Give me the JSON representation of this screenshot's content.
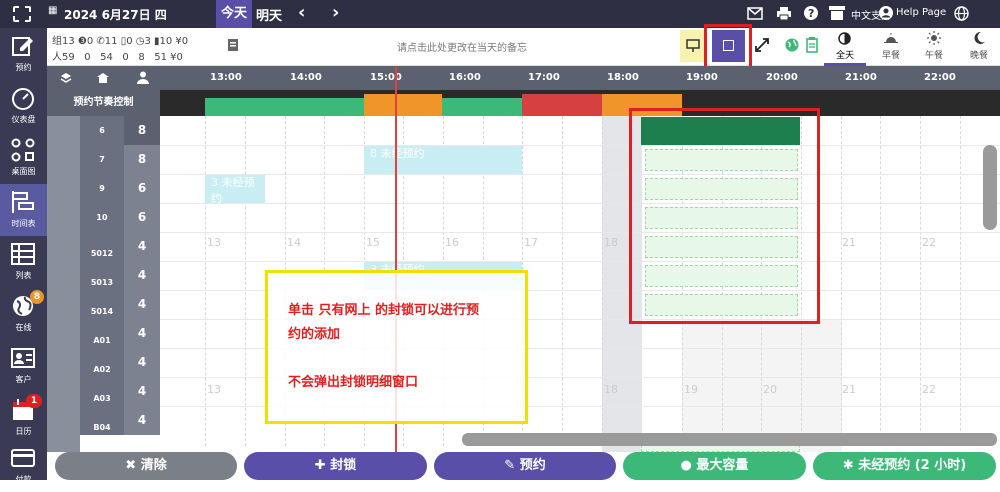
{
  "topbar": {
    "date": "2024 6月27日 四",
    "today": "今天",
    "tomorrow": "明天",
    "prev": "‹",
    "next": "›",
    "lang_support": "中文支持",
    "help": "Help Page"
  },
  "sidebar": [
    {
      "label": "预约",
      "icon": "edit-icon"
    },
    {
      "label": "仪表盘",
      "icon": "gauge-icon"
    },
    {
      "label": "桌面图",
      "icon": "floorplan-icon"
    },
    {
      "label": "时间表",
      "icon": "timeline-icon",
      "active": true
    },
    {
      "label": "列表",
      "icon": "list-icon"
    },
    {
      "label": "在线",
      "icon": "globe-icon",
      "badge": "8"
    },
    {
      "label": "客户",
      "icon": "contact-icon"
    },
    {
      "label": "日历",
      "icon": "calendar-icon",
      "badge": "1"
    },
    {
      "label": "付款",
      "icon": "card-icon"
    }
  ],
  "toolbar": {
    "stats_line1": "组13 ❸0 ✆11 ▯0 ◷3 ▮10 ¥0",
    "stats_line2": "人59   0   54   0   8   51 ¥0",
    "memo": "请点击此处更改在当天的备忘",
    "meal_all": "全天",
    "meal_breakfast": "早餐",
    "meal_lunch": "午餐",
    "meal_dinner": "晚餐"
  },
  "header": {
    "times": [
      "13:00",
      "14:00",
      "15:00",
      "16:00",
      "17:00",
      "18:00",
      "19:00",
      "20:00",
      "21:00",
      "22:00"
    ],
    "rhythm_label": "预约节奏控制"
  },
  "rows": [
    {
      "name": "6",
      "cap": "8",
      "highlight": true
    },
    {
      "name": "7",
      "cap": "8"
    },
    {
      "name": "9",
      "cap": "6"
    },
    {
      "name": "10",
      "cap": "6"
    },
    {
      "name": "5012",
      "cap": "4"
    },
    {
      "name": "5013",
      "cap": "4"
    },
    {
      "name": "5014",
      "cap": "4"
    },
    {
      "name": "A01",
      "cap": "4"
    },
    {
      "name": "A02",
      "cap": "4"
    },
    {
      "name": "A03",
      "cap": "4"
    },
    {
      "name": "B04",
      "cap": "4"
    }
  ],
  "bookings": [
    {
      "text": "8  未经预约"
    },
    {
      "text": "3  未经预约"
    },
    {
      "text": "3  未经预约"
    }
  ],
  "ghost_hours": [
    "13",
    "14",
    "15",
    "16",
    "17",
    "18",
    "19",
    "20",
    "21",
    "22"
  ],
  "annotation": {
    "line1": "单击 只有网上 的封锁可以进行预",
    "line2": "约的添加",
    "line3": "不会弹出封锁明细窗口"
  },
  "buttons": {
    "clear": "清除",
    "block": "封锁",
    "reserve": "预约",
    "max_capacity": "最大容量",
    "walkin": "未经预约 (2 小时)"
  },
  "colors": {
    "accent": "#5a4fa8",
    "green": "#3cb878",
    "red": "#e02020",
    "yellow": "#f0e000"
  }
}
